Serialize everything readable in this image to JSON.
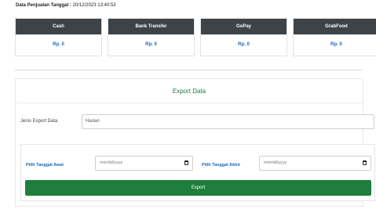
{
  "heading": {
    "label": "Data Penjualan Tanggal :",
    "datetime": " 20/12/2023 13:40:53"
  },
  "payments": [
    {
      "method": "Cash",
      "amount": "Rp. 0"
    },
    {
      "method": "Bank Transfer",
      "amount": "Rp. 0"
    },
    {
      "method": "GoPay",
      "amount": "Rp. 0"
    },
    {
      "method": "GrabFood",
      "amount": "Rp. 0"
    }
  ],
  "export": {
    "title": "Export Data",
    "jenis_label": "Jenis Export Data",
    "jenis_value": "Harian",
    "start_label": "Pilih Tanggal Awal",
    "start_placeholder": "mm/dd/yyyy",
    "end_label": "Pilih Tanggal Akhir",
    "end_placeholder": "mm/dd/yyyy",
    "button": "Export"
  },
  "colors": {
    "card_header": "#3e4348",
    "amount_text": "#1565c0",
    "accent_green": "#1e7e3e"
  }
}
